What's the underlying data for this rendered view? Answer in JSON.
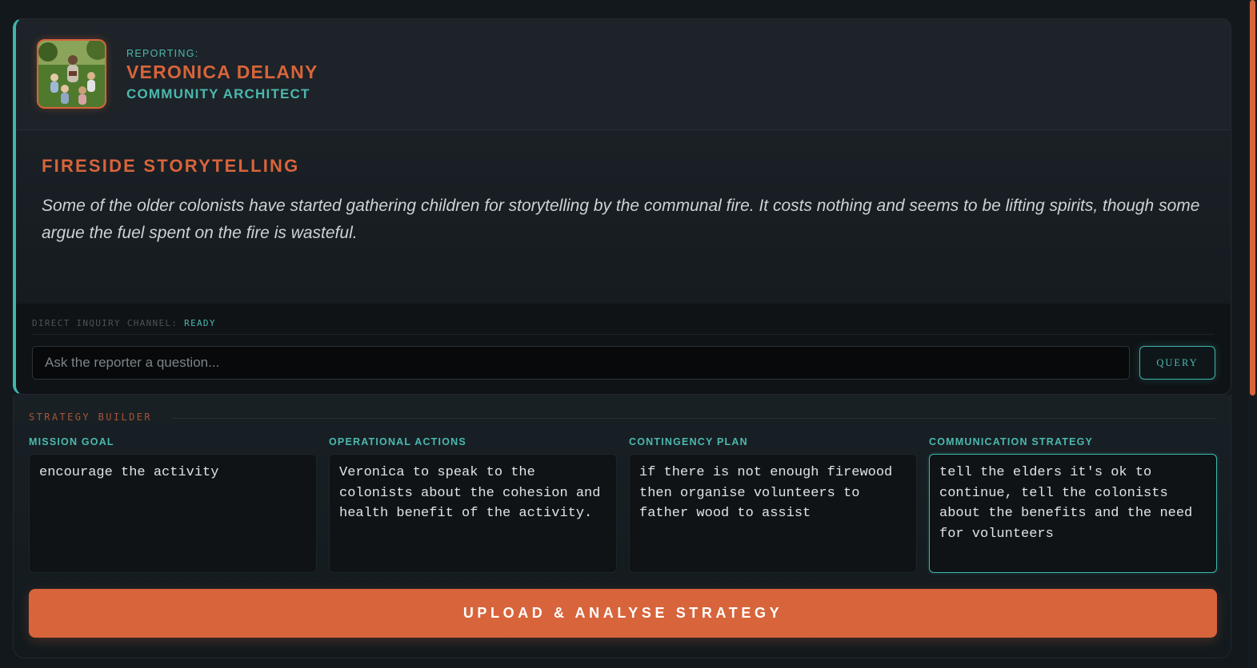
{
  "reporter": {
    "reporting_label": "REPORTING:",
    "name": "VERONICA DELANY",
    "role": "COMMUNITY ARCHITECT",
    "avatar_icon": "storyteller-photo"
  },
  "report": {
    "title": "FIRESIDE STORYTELLING",
    "text": "Some of the older colonists have started gathering children for storytelling by the communal fire. It costs nothing and seems to be lifting spirits, though some argue the fuel spent on the fire is wasteful."
  },
  "inquiry": {
    "status_label": "DIRECT INQUIRY CHANNEL:",
    "status_value": "READY",
    "placeholder": "Ask the reporter a question...",
    "value": "",
    "query_label": "QUERY"
  },
  "strategy": {
    "heading": "STRATEGY BUILDER",
    "fields": [
      {
        "label": "MISSION GOAL",
        "value": "encourage the activity"
      },
      {
        "label": "OPERATIONAL ACTIONS",
        "value": "Veronica to speak to the colonists about the cohesion and health benefit of the activity."
      },
      {
        "label": "CONTINGENCY PLAN",
        "value": "if there is not enough firewood then organise volunteers to father wood to assist"
      },
      {
        "label": "COMMUNICATION STRATEGY",
        "value": "tell the elders it's ok to continue, tell the colonists about the benefits and the need for volunteers"
      }
    ],
    "upload_label": "UPLOAD & ANALYSE STRATEGY"
  },
  "colors": {
    "accent_orange": "#d8643b",
    "accent_teal": "#3fb6ac",
    "background": "#13181c"
  }
}
